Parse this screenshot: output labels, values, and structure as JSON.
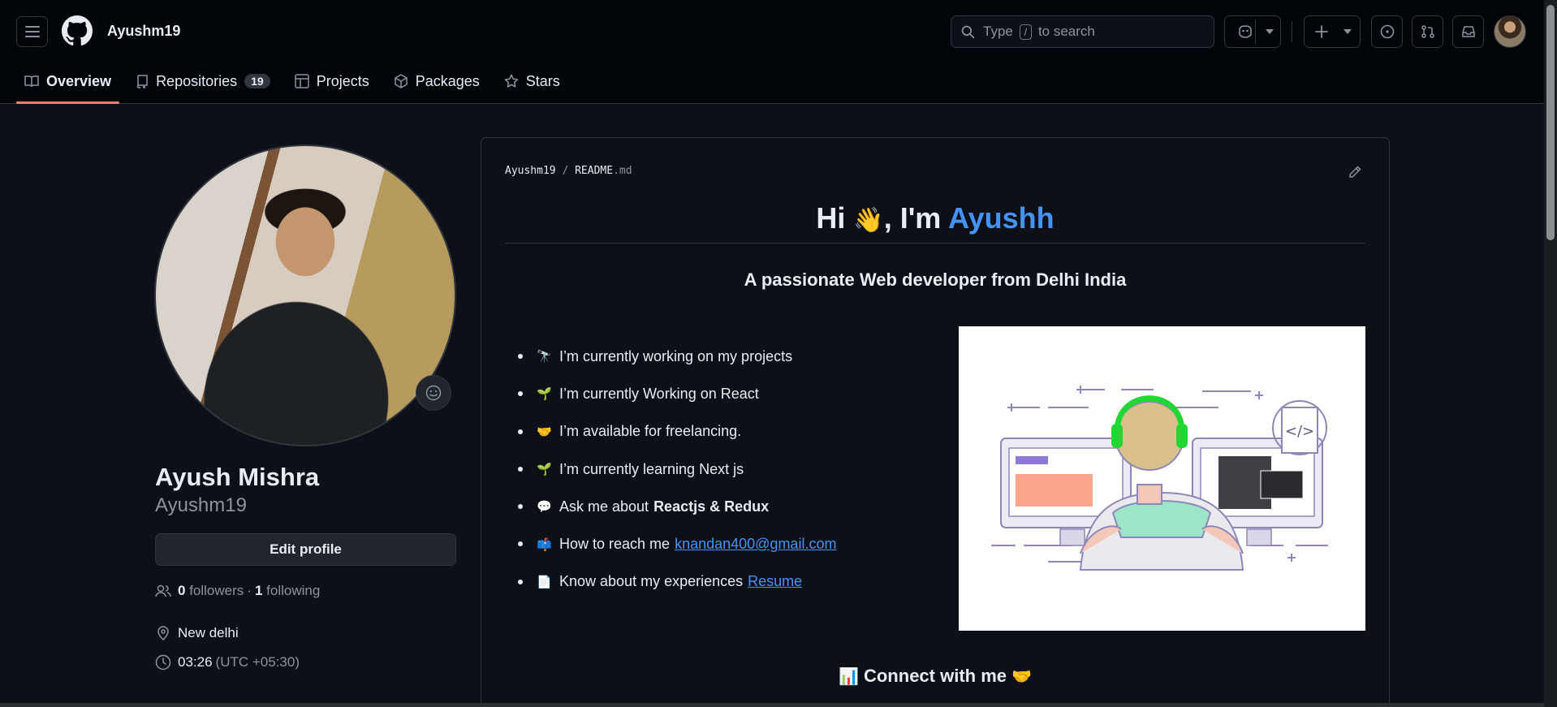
{
  "header": {
    "username": "Ayushm19",
    "search": {
      "prefix": "Type",
      "key": "/",
      "suffix": "to search"
    },
    "icons": [
      "menu-icon",
      "github-logo",
      "copilot-icon",
      "plus-icon",
      "issues-icon",
      "pull-requests-icon",
      "inbox-icon"
    ]
  },
  "nav": {
    "tabs": [
      {
        "label": "Overview",
        "icon": "book-icon",
        "active": true
      },
      {
        "label": "Repositories",
        "icon": "repo-icon",
        "count": "19"
      },
      {
        "label": "Projects",
        "icon": "table-icon"
      },
      {
        "label": "Packages",
        "icon": "package-icon"
      },
      {
        "label": "Stars",
        "icon": "star-icon"
      }
    ]
  },
  "profile": {
    "name": "Ayush Mishra",
    "login": "Ayushm19",
    "edit_label": "Edit profile",
    "followers_count": "0",
    "followers_label": "followers",
    "dot": "·",
    "following_count": "1",
    "following_label": "following",
    "location": "New delhi",
    "time": "03:26",
    "timezone": "(UTC +05:30)"
  },
  "readme": {
    "owner": "Ayushm19",
    "sep": "/",
    "file": "README",
    "ext": ".md",
    "greeting_pre": "Hi",
    "greeting_emoji": "👋",
    "greeting_mid": ", I'm",
    "greeting_name": "Ayushh",
    "subtitle": "A passionate Web developer from Delhi India",
    "bullets": [
      {
        "emoji": "🔭",
        "text": "I’m currently working on my projects"
      },
      {
        "emoji": "🌱",
        "text": "I’m currently Working on React"
      },
      {
        "emoji": "🤝",
        "text": "I’m available for freelancing."
      },
      {
        "emoji": "🌱",
        "text": "I’m currently learning Next js"
      },
      {
        "emoji": "💬",
        "text": "Ask me about",
        "bold": "Reactjs & Redux"
      },
      {
        "emoji": "📫",
        "text": "How to reach me",
        "link": "knandan400@gmail.com"
      },
      {
        "emoji": "📄",
        "text": "Know about my experiences",
        "link": "Resume"
      }
    ],
    "connect_icon": "📊",
    "connect": "Connect with me",
    "connect_emoji": "🤝"
  },
  "colors": {
    "accent_blue": "#4493f8",
    "active_tab": "#f78166",
    "bg": "#0d1117",
    "header_bg": "#010409"
  }
}
